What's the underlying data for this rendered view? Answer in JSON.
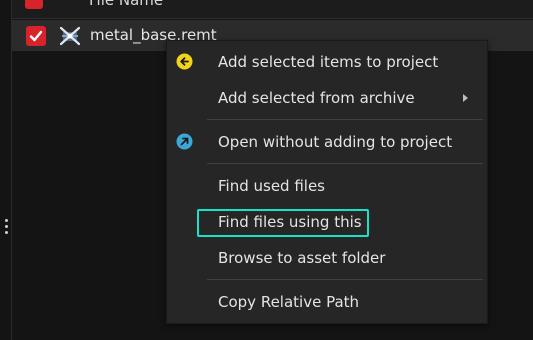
{
  "panel": {
    "header_label": "File Name",
    "row": {
      "file_name": "metal_base.remt",
      "checked": true
    }
  },
  "context_menu": {
    "items": [
      {
        "label": "Add selected items to project",
        "icon": "arrow-left-icon",
        "icon_color": "#f2d21b"
      },
      {
        "label": "Add selected from archive",
        "submenu": true
      },
      {
        "label": "Open without adding to project",
        "icon": "arrow-up-right-icon",
        "icon_color": "#3aa8d8"
      },
      {
        "label": "Find used files"
      },
      {
        "label": "Find files using this",
        "highlighted": true
      },
      {
        "label": "Browse to asset folder"
      },
      {
        "label": "Copy Relative Path"
      }
    ]
  },
  "colors": {
    "checkbox": "#d8232a",
    "highlight": "#19e0c8"
  }
}
